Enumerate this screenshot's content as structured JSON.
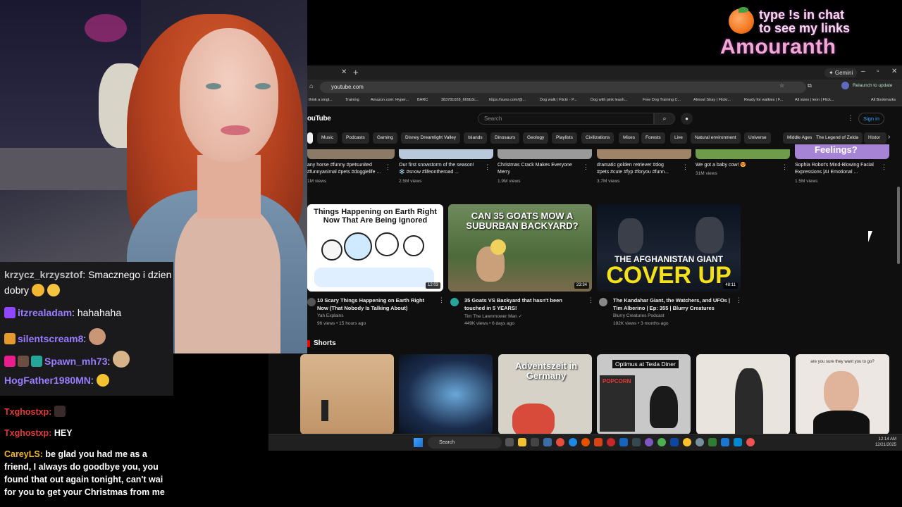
{
  "overlay": {
    "links_line1": "type !s in chat",
    "links_line2": "to see my links",
    "brand": "Amouranth"
  },
  "chat": {
    "messages": [
      {
        "user": "krzycz_krzysztof",
        "text": "Smacznego i dzien",
        "text2": "dobry",
        "color": "#bdbdbd"
      },
      {
        "user": "itzrealadam",
        "text": "hahahaha",
        "color": "#9a7dff"
      },
      {
        "user": "silentscream8",
        "text": "",
        "color": "#9a7dff"
      },
      {
        "user": "Spawn_mh73",
        "text": "",
        "color": "#9a7dff"
      },
      {
        "user": "HogFather1980MN",
        "text": "",
        "color": "#9a7dff"
      }
    ],
    "messages2": [
      {
        "user": "Txghostxp",
        "text": ""
      },
      {
        "user": "Txghostxp",
        "text": "HEY"
      },
      {
        "user": "CareyLS",
        "text": "be glad you had me as a friend, I always do goodbye you, you found that out again tonight, can't wai for you to get your Christmas from me"
      }
    ]
  },
  "browser": {
    "gemini": "✦ Gemini",
    "url": "youtube.com",
    "relaunch": "Relaunch to update",
    "bookmarks": [
      "think a singl...",
      "Training",
      "Amazon.com: Hyper...",
      "BARC",
      "383781028_669b3c...",
      "https://suno.com/@...",
      "Dog walk | Flickr - P...",
      "Dog with pink leash...",
      "Free Dog Training C...",
      "Almost Stray | Flickr...",
      "Ready for walkies | F...",
      "All sizes | leon | Flick...",
      "All Bookmarks"
    ]
  },
  "youtube": {
    "logo": "ouTube",
    "search_placeholder": "Search",
    "sign_in": "Sign in",
    "chips": [
      "Music",
      "Podcasts",
      "Gaming",
      "Disney Dreamlight Valley",
      "Islands",
      "Dinosaurs",
      "Geology",
      "Playlists",
      "Civilizations",
      "Mixes",
      "Forests",
      "Live",
      "Natural environment",
      "Universe",
      "Middle Ages",
      "The Legend of Zelda",
      "Histor"
    ],
    "row1": [
      {
        "title": "any horse #funny #petsunited #funnyanimal #pets #doggielife ...",
        "views": "1M views"
      },
      {
        "title": "Our first snowstorm of the season! ❄️ #snow #lifeontheroad ...",
        "views": "2.5M views"
      },
      {
        "title": "Christmas Crack Makes Everyone Merry",
        "views": "1.9M views"
      },
      {
        "title": "dramatic golden retriever #dog #pets #cute #fyp #foryou #funn...",
        "views": "3.7M views"
      },
      {
        "title": "We got a baby cow! 😍",
        "views": "31M views"
      },
      {
        "title": "Sophia Robot's Mind-Blowing Facial Expressions |AI Emotional ...",
        "views": "1.5M views"
      }
    ],
    "row1_thumb_text": "Feelings?",
    "videos": [
      {
        "thumb_text": "Things Happening on Earth Right Now That Are Being Ignored",
        "duration": "12:03",
        "title": "10 Scary Things Happening on Earth Right Now (That Nobody Is Talking About)",
        "channel": "Yah Explains",
        "meta": "96 views • 15 hours ago"
      },
      {
        "thumb_text": "CAN 35 GOATS MOW A SUBURBAN BACKYARD?",
        "duration": "23:34",
        "title": "35 Goats VS Backyard that hasn't been touched in 5 YEARS!",
        "channel": "Tim The Lawnmower Man ✓",
        "meta": "449K views • 6 days ago"
      },
      {
        "thumb_text": "THE AFGHANISTAN GIANT",
        "thumb_text2": "COVER UP",
        "duration": "48:11",
        "title": "The Kandahar Giant, the Watchers, and UFOs | Tim Alberino | Ep: 355 | Blurry Creatures",
        "channel": "Blurry Creatures Podcast",
        "meta": "182K views • 3 months ago"
      }
    ],
    "shorts_label": "Shorts",
    "shorts": [
      {
        "text": ""
      },
      {
        "text": ""
      },
      {
        "text": "Adventszeit in Germany"
      },
      {
        "text": "Optimus at Tesla Diner",
        "sub": "POPCORN"
      },
      {
        "text": ""
      },
      {
        "text": "are you sure they want you to go?"
      }
    ]
  },
  "taskbar": {
    "search": "Search",
    "time": "12:14 AM",
    "date": "12/21/2025"
  }
}
